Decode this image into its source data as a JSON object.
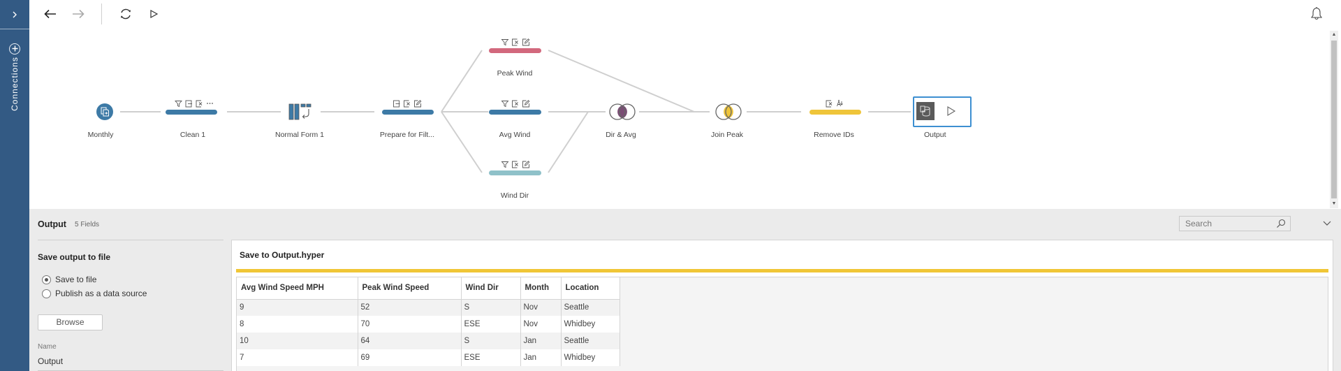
{
  "rail": {
    "toggle_icon": "chevron-right-icon",
    "add_icon": "plus-circle-icon",
    "label": "Connections"
  },
  "toolbar": {
    "back_icon": "arrow-left-icon",
    "forward_icon": "arrow-right-icon",
    "refresh_icon": "refresh-icon",
    "run_icon": "play-icon",
    "notifications_icon": "bell-icon"
  },
  "flow": {
    "nodes": [
      {
        "id": "monthly",
        "label": "Monthly",
        "kind": "input"
      },
      {
        "id": "clean1",
        "label": "Clean 1",
        "kind": "clean",
        "color": "#3d7aa6",
        "icons": [
          "filter-icon",
          "rename-icon",
          "remove-icon",
          "more-icon"
        ]
      },
      {
        "id": "normal1",
        "label": "Normal Form 1",
        "kind": "pivot"
      },
      {
        "id": "prepare",
        "label": "Prepare for Filt...",
        "kind": "clean",
        "color": "#3d7aa6",
        "icons": [
          "rename-icon",
          "remove-icon",
          "edit-icon"
        ]
      },
      {
        "id": "peak",
        "label": "Peak Wind",
        "kind": "clean",
        "color": "#d2687d",
        "icons": [
          "filter-icon",
          "remove-icon",
          "edit-icon"
        ]
      },
      {
        "id": "avg",
        "label": "Avg Wind",
        "kind": "clean",
        "color": "#3d7aa6",
        "icons": [
          "filter-icon",
          "remove-icon",
          "edit-icon"
        ]
      },
      {
        "id": "dir",
        "label": "Wind Dir",
        "kind": "clean",
        "color": "#8fc1c9",
        "icons": [
          "filter-icon",
          "remove-icon",
          "edit-icon"
        ]
      },
      {
        "id": "diravg",
        "label": "Dir & Avg",
        "kind": "join",
        "color": "#7b4c75"
      },
      {
        "id": "joinpeak",
        "label": "Join Peak",
        "kind": "join",
        "color": "#efc53a"
      },
      {
        "id": "removeids",
        "label": "Remove IDs",
        "kind": "clean",
        "color": "#efc53a",
        "icons": [
          "remove-icon",
          "split-icon"
        ]
      },
      {
        "id": "output",
        "label": "Output",
        "kind": "output"
      }
    ]
  },
  "panel": {
    "title": "Output",
    "subtitle": "5 Fields",
    "search_placeholder": "Search",
    "settings": {
      "heading": "Save output to file",
      "options": [
        {
          "label": "Save to file",
          "selected": true
        },
        {
          "label": "Publish as a data source",
          "selected": false
        }
      ],
      "browse_label": "Browse",
      "name_label": "Name",
      "name_value": "Output"
    },
    "preview": {
      "title": "Save to Output.hyper",
      "accent": "#f0c636",
      "columns": [
        "Avg Wind Speed MPH",
        "Peak Wind Speed",
        "Wind Dir",
        "Month",
        "Location"
      ],
      "rows": [
        [
          "9",
          "52",
          "S",
          "Nov",
          "Seattle"
        ],
        [
          "8",
          "70",
          "ESE",
          "Nov",
          "Whidbey"
        ],
        [
          "10",
          "64",
          "S",
          "Jan",
          "Seattle"
        ],
        [
          "7",
          "69",
          "ESE",
          "Jan",
          "Whidbey"
        ]
      ]
    }
  }
}
